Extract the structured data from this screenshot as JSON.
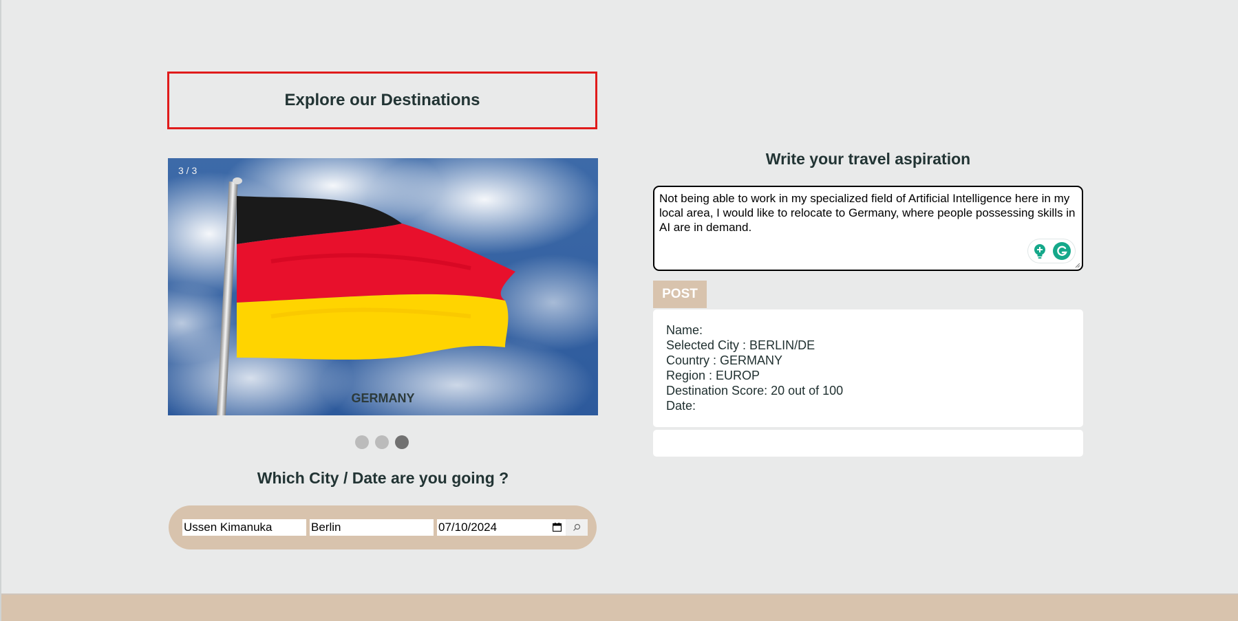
{
  "explore": {
    "title": "Explore our Destinations"
  },
  "slideshow": {
    "counter": "3 / 3",
    "caption": "GERMANY",
    "flag_colors": [
      "#1a1a1a",
      "#e8102c",
      "#ffd400"
    ],
    "active_dot": 3
  },
  "city_form": {
    "title": "Which City / Date are you going ?",
    "name_value": "Ussen Kimanuka",
    "city_value": "Berlin",
    "date_value": "07/10/2024"
  },
  "aspiration": {
    "title": "Write your travel aspiration",
    "text": "Not being able to work in my specialized field of Artificial Intelligence here in my local area, I would like to relocate to Germany, where people possessing skills in AI are in demand.",
    "post_label": "POST"
  },
  "info": {
    "name": "Name:",
    "city": "Selected City : BERLIN/DE",
    "country": "Country : GERMANY",
    "region": "Region : EUROP",
    "score": "Destination Score: 20 out of 100",
    "date": "Date:"
  },
  "colors": {
    "accent_beige": "#d8c3ad",
    "frame_red": "#e01b1b",
    "heading": "#223434",
    "grammarly_green": "#15a88a"
  }
}
